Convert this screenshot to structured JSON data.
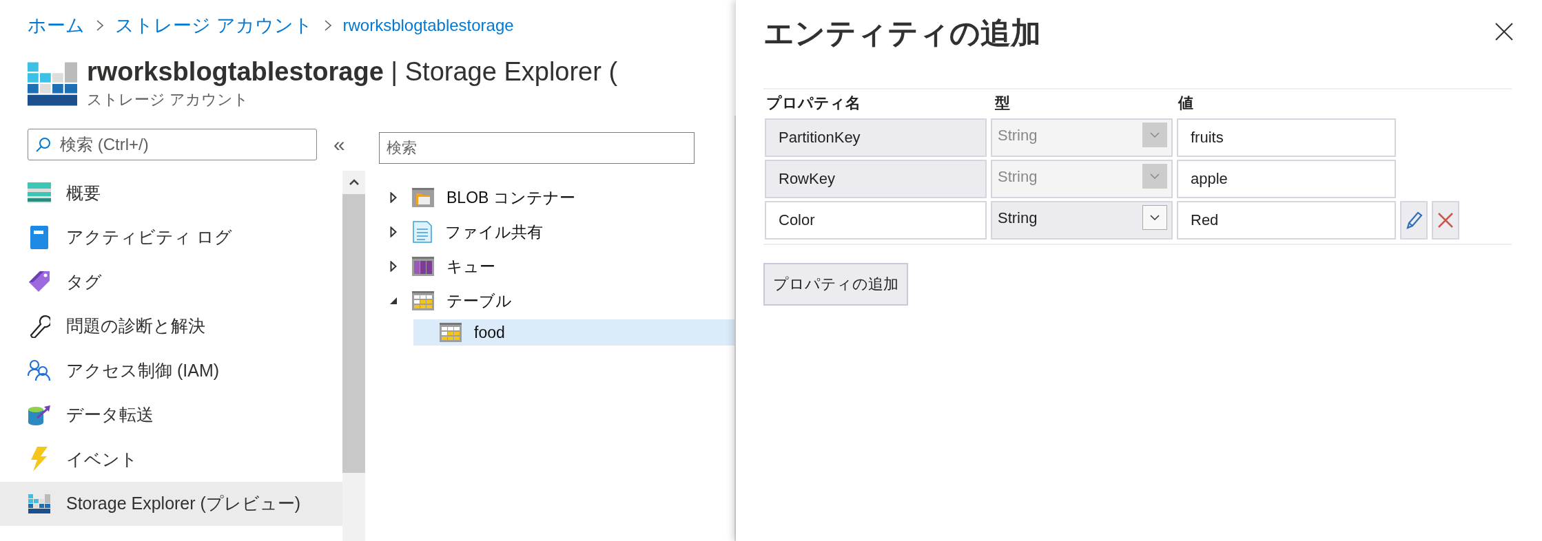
{
  "breadcrumb": [
    "ホーム",
    "ストレージ アカウント",
    "rworksblogtablestorage"
  ],
  "header": {
    "title_bold": "rworksblogtablestorage",
    "title_rest": " | Storage Explorer (",
    "subtitle": "ストレージ アカウント"
  },
  "nav": {
    "search": {
      "placeholder": "検索 (Ctrl+/)"
    },
    "collapse": "«",
    "items": [
      {
        "label": "概要",
        "selected": false
      },
      {
        "label": "アクティビティ ログ",
        "selected": false
      },
      {
        "label": "タグ",
        "selected": false
      },
      {
        "label": "問題の診断と解決",
        "selected": false
      },
      {
        "label": "アクセス制御 (IAM)",
        "selected": false
      },
      {
        "label": "データ転送",
        "selected": false
      },
      {
        "label": "イベント",
        "selected": false
      },
      {
        "label": "Storage Explorer (プレビュー)",
        "selected": true
      }
    ]
  },
  "explorer": {
    "search": {
      "placeholder": "検索"
    },
    "items": [
      {
        "label": "BLOB コンテナー",
        "expanded": false
      },
      {
        "label": "ファイル共有",
        "expanded": false
      },
      {
        "label": "キュー",
        "expanded": false
      },
      {
        "label": "テーブル",
        "expanded": true,
        "children": [
          {
            "label": "food",
            "selected": true
          }
        ]
      }
    ]
  },
  "panel": {
    "title": "エンティティの追加",
    "columns": [
      "プロパティ名",
      "型",
      "値"
    ],
    "rows": [
      {
        "name": "PartitionKey",
        "type": "String",
        "value": "fruits",
        "disabled": true
      },
      {
        "name": "RowKey",
        "type": "String",
        "value": "apple",
        "disabled": true
      },
      {
        "name": "Color",
        "type": "String",
        "value": "Red",
        "disabled": false
      }
    ],
    "add_button": "プロパティの追加"
  }
}
